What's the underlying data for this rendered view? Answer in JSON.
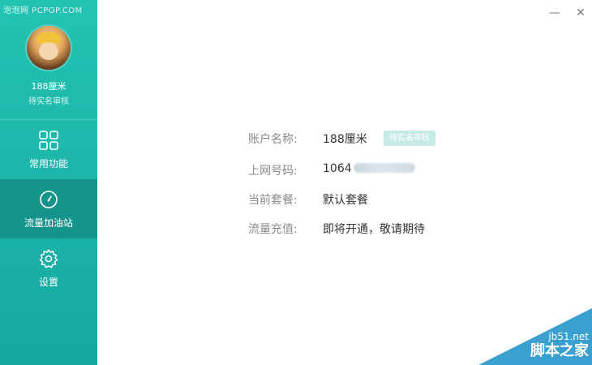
{
  "watermark_top": "泡泡网 PCPOP.COM",
  "sidebar": {
    "user_name": "188厘米",
    "user_status": "待实名审核",
    "items": [
      {
        "label": "常用功能",
        "icon": "grid-icon"
      },
      {
        "label": "流量加油站",
        "icon": "gauge-icon"
      },
      {
        "label": "设置",
        "icon": "gear-icon"
      }
    ]
  },
  "window": {
    "minimize": "—",
    "close": "✕"
  },
  "account": {
    "rows": [
      {
        "key": "账户名称:",
        "value": "188厘米"
      },
      {
        "key": "上网号码:",
        "value": "1064"
      },
      {
        "key": "当前套餐:",
        "value": "默认套餐"
      },
      {
        "key": "流量充值:",
        "value": "即将开通，敬请期待"
      }
    ],
    "badge": "待实名审核"
  },
  "watermark_corner": {
    "site": "jb51.net",
    "brand": "脚本之家"
  },
  "colors": {
    "sidebar": "#1bb3a8",
    "active_item": "#14948b",
    "badge_bg": "#c6ebe6"
  }
}
